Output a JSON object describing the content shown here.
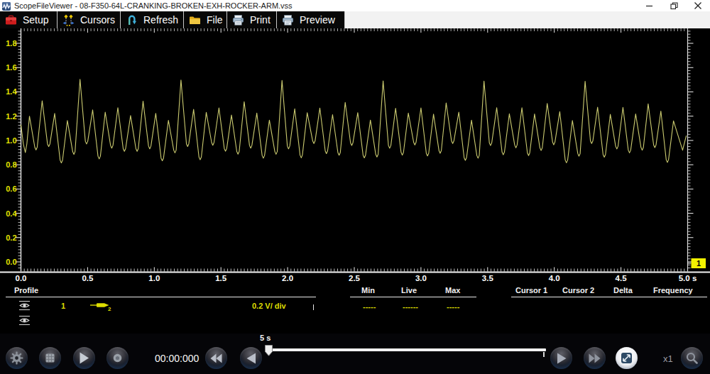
{
  "window": {
    "title": "ScopeFileViewer - 08-F350-64L-CRANKING-BROKEN-EXH-ROCKER-ARM.vss"
  },
  "menu": {
    "items": [
      {
        "label": "Setup"
      },
      {
        "label": "Cursors"
      },
      {
        "label": "Refresh"
      },
      {
        "label": "File"
      },
      {
        "label": "Print"
      },
      {
        "label": "Preview"
      }
    ]
  },
  "chart_data": {
    "type": "line",
    "title": "",
    "xlabel": "s",
    "ylabel": "V",
    "xlim": [
      0,
      5
    ],
    "ylim": [
      0,
      1.8
    ],
    "grid": false,
    "background": "#000000",
    "axis_color": "#ffffff",
    "x_ticks": {
      "values": [
        0,
        0.5,
        1.0,
        1.5,
        2.0,
        2.5,
        3.0,
        3.5,
        4.0,
        4.5,
        5.0
      ],
      "labels": [
        "0.0",
        "0.5",
        "1.0",
        "1.5",
        "2.0",
        "2.5",
        "3.0",
        "3.5",
        "4.0",
        "4.5",
        "5.0 s"
      ],
      "label_color": "#ffffff",
      "minor_step": 0.025
    },
    "y_ticks": {
      "values": [
        0,
        0.2,
        0.4,
        0.6,
        0.8,
        1.0,
        1.2,
        1.4,
        1.6,
        1.8
      ],
      "labels": [
        "0.0",
        "0.2",
        "0.4",
        "0.6",
        "0.8",
        "1.0",
        "1.2",
        "1.4",
        "1.6",
        "1.8"
      ],
      "label_color": "#e3e300",
      "minor_step": 0.025
    },
    "channel_marker": {
      "label": "1",
      "value": 0.0,
      "bg": "#f2f200",
      "fg": "#000000"
    },
    "series": [
      {
        "name": "Channel 1",
        "color": "#cbcb70",
        "scale": "0.2 V/ div",
        "points": [
          [
            0.0,
            1.13
          ],
          [
            0.018,
            0.97
          ],
          [
            0.033,
            0.9
          ],
          [
            0.044,
            0.97
          ],
          [
            0.064,
            1.2
          ],
          [
            0.104,
            0.944
          ],
          [
            0.113,
            0.922
          ],
          [
            0.122,
            0.944
          ],
          [
            0.159,
            1.327
          ],
          [
            0.199,
            0.971
          ],
          [
            0.208,
            0.949
          ],
          [
            0.217,
            0.971
          ],
          [
            0.253,
            1.222
          ],
          [
            0.294,
            0.837
          ],
          [
            0.303,
            0.815
          ],
          [
            0.312,
            0.837
          ],
          [
            0.348,
            1.164
          ],
          [
            0.388,
            0.907
          ],
          [
            0.397,
            0.885
          ],
          [
            0.406,
            0.907
          ],
          [
            0.443,
            1.503
          ],
          [
            0.483,
            0.993
          ],
          [
            0.492,
            0.971
          ],
          [
            0.501,
            0.993
          ],
          [
            0.538,
            1.252
          ],
          [
            0.578,
            0.87
          ],
          [
            0.587,
            0.848
          ],
          [
            0.596,
            0.87
          ],
          [
            0.632,
            1.233
          ],
          [
            0.672,
            0.959
          ],
          [
            0.681,
            0.937
          ],
          [
            0.69,
            0.959
          ],
          [
            0.727,
            1.27
          ],
          [
            0.767,
            0.932
          ],
          [
            0.776,
            0.91
          ],
          [
            0.785,
            0.932
          ],
          [
            0.822,
            1.205
          ],
          [
            0.862,
            0.932
          ],
          [
            0.871,
            0.91
          ],
          [
            0.88,
            0.932
          ],
          [
            0.916,
            1.323
          ],
          [
            0.957,
            0.953
          ],
          [
            0.966,
            0.931
          ],
          [
            0.975,
            0.953
          ],
          [
            1.011,
            1.223
          ],
          [
            1.051,
            0.854
          ],
          [
            1.06,
            0.832
          ],
          [
            1.069,
            0.854
          ],
          [
            1.106,
            1.166
          ],
          [
            1.146,
            0.92
          ],
          [
            1.155,
            0.898
          ],
          [
            1.164,
            0.92
          ],
          [
            1.2,
            1.498
          ],
          [
            1.241,
            0.972
          ],
          [
            1.25,
            0.95
          ],
          [
            1.259,
            0.972
          ],
          [
            1.295,
            1.256
          ],
          [
            1.335,
            0.863
          ],
          [
            1.344,
            0.841
          ],
          [
            1.353,
            0.863
          ],
          [
            1.39,
            1.231
          ],
          [
            1.43,
            0.982
          ],
          [
            1.439,
            0.96
          ],
          [
            1.448,
            0.982
          ],
          [
            1.485,
            1.268
          ],
          [
            1.525,
            0.933
          ],
          [
            1.534,
            0.911
          ],
          [
            1.543,
            0.933
          ],
          [
            1.579,
            1.209
          ],
          [
            1.619,
            0.909
          ],
          [
            1.628,
            0.887
          ],
          [
            1.637,
            0.909
          ],
          [
            1.674,
            1.319
          ],
          [
            1.714,
            0.959
          ],
          [
            1.723,
            0.937
          ],
          [
            1.732,
            0.959
          ],
          [
            1.769,
            1.225
          ],
          [
            1.809,
            0.876
          ],
          [
            1.818,
            0.854
          ],
          [
            1.827,
            0.876
          ],
          [
            1.863,
            1.168
          ],
          [
            1.904,
            0.908
          ],
          [
            1.913,
            0.886
          ],
          [
            1.922,
            0.908
          ],
          [
            1.958,
            1.494
          ],
          [
            1.998,
            0.953
          ],
          [
            2.007,
            0.931
          ],
          [
            2.016,
            0.953
          ],
          [
            2.053,
            1.261
          ],
          [
            2.093,
            0.879
          ],
          [
            2.102,
            0.857
          ],
          [
            2.111,
            0.879
          ],
          [
            2.147,
            1.228
          ],
          [
            2.188,
            0.996
          ],
          [
            2.197,
            0.974
          ],
          [
            2.206,
            0.996
          ],
          [
            2.242,
            1.267
          ],
          [
            2.282,
            0.913
          ],
          [
            2.291,
            0.891
          ],
          [
            2.3,
            0.913
          ],
          [
            2.337,
            1.213
          ],
          [
            2.377,
            0.9
          ],
          [
            2.386,
            0.878
          ],
          [
            2.395,
            0.9
          ],
          [
            2.432,
            1.314
          ],
          [
            2.472,
            0.981
          ],
          [
            2.481,
            0.959
          ],
          [
            2.49,
            0.981
          ],
          [
            2.526,
            1.229
          ],
          [
            2.566,
            0.878
          ],
          [
            2.575,
            0.856
          ],
          [
            2.584,
            0.878
          ],
          [
            2.621,
            1.168
          ],
          [
            2.661,
            0.885
          ],
          [
            2.67,
            0.863
          ],
          [
            2.679,
            0.885
          ],
          [
            2.716,
            1.49
          ],
          [
            2.756,
            0.958
          ],
          [
            2.765,
            0.936
          ],
          [
            2.774,
            0.958
          ],
          [
            2.81,
            1.265
          ],
          [
            2.851,
            0.901
          ],
          [
            2.86,
            0.879
          ],
          [
            2.869,
            0.901
          ],
          [
            2.905,
            1.225
          ],
          [
            2.945,
            0.985
          ],
          [
            2.954,
            0.963
          ],
          [
            2.963,
            0.985
          ],
          [
            3.0,
            1.268
          ],
          [
            3.04,
            0.894
          ],
          [
            3.049,
            0.872
          ],
          [
            3.058,
            0.894
          ],
          [
            3.094,
            1.216
          ],
          [
            3.135,
            0.916
          ],
          [
            3.144,
            0.894
          ],
          [
            3.153,
            0.916
          ],
          [
            3.189,
            1.309
          ],
          [
            3.229,
            0.996
          ],
          [
            3.238,
            0.974
          ],
          [
            3.247,
            0.996
          ],
          [
            3.284,
            1.233
          ],
          [
            3.324,
            0.858
          ],
          [
            3.333,
            0.836
          ],
          [
            3.342,
            0.858
          ],
          [
            3.379,
            1.167
          ],
          [
            3.419,
            0.876
          ],
          [
            3.428,
            0.854
          ],
          [
            3.437,
            0.876
          ],
          [
            3.473,
            1.488
          ],
          [
            3.513,
            0.98
          ],
          [
            3.522,
            0.958
          ],
          [
            3.531,
            0.98
          ],
          [
            3.568,
            1.27
          ],
          [
            3.608,
            0.904
          ],
          [
            3.617,
            0.882
          ],
          [
            3.626,
            0.904
          ],
          [
            3.663,
            1.22
          ],
          [
            3.703,
            0.962
          ],
          [
            3.712,
            0.94
          ],
          [
            3.721,
            0.962
          ],
          [
            3.757,
            1.269
          ],
          [
            3.798,
            0.897
          ],
          [
            3.807,
            0.875
          ],
          [
            3.816,
            0.897
          ],
          [
            3.852,
            1.218
          ],
          [
            3.892,
            0.939
          ],
          [
            3.901,
            0.917
          ],
          [
            3.91,
            0.939
          ],
          [
            3.947,
            1.305
          ],
          [
            3.987,
            0.986
          ],
          [
            3.996,
            0.964
          ],
          [
            4.005,
            0.986
          ],
          [
            4.041,
            1.237
          ],
          [
            4.082,
            0.838
          ],
          [
            4.091,
            0.816
          ],
          [
            4.1,
            0.838
          ],
          [
            4.136,
            1.164
          ],
          [
            4.176,
            0.892
          ],
          [
            4.185,
            0.87
          ],
          [
            4.194,
            0.892
          ],
          [
            4.231,
            1.487
          ],
          [
            4.271,
            0.996
          ],
          [
            4.28,
            0.974
          ],
          [
            4.289,
            0.996
          ],
          [
            4.325,
            1.274
          ],
          [
            4.366,
            0.884
          ],
          [
            4.375,
            0.862
          ],
          [
            4.384,
            0.884
          ],
          [
            4.42,
            1.215
          ],
          [
            4.46,
            0.952
          ],
          [
            4.469,
            0.93
          ],
          [
            4.478,
            0.952
          ],
          [
            4.515,
            1.273
          ],
          [
            4.555,
            0.92
          ],
          [
            4.564,
            0.898
          ],
          [
            4.573,
            0.92
          ],
          [
            4.61,
            1.218
          ],
          [
            4.65,
            0.942
          ],
          [
            4.659,
            0.92
          ],
          [
            4.668,
            0.942
          ],
          [
            4.704,
            1.301
          ],
          [
            4.745,
            0.963
          ],
          [
            4.754,
            0.941
          ],
          [
            4.763,
            0.963
          ],
          [
            4.799,
            1.242
          ],
          [
            4.839,
            0.841
          ],
          [
            4.848,
            0.819
          ],
          [
            4.857,
            0.841
          ],
          [
            4.894,
            1.161
          ],
          [
            4.962,
            0.92
          ],
          [
            4.99,
            1.04
          ]
        ]
      }
    ]
  },
  "readout": {
    "profile_header": "Profile",
    "channel_row": {
      "channel": "1",
      "scale": "0.2 V/ div",
      "probe_label": "2"
    },
    "stats": {
      "headers": [
        "Min",
        "Live",
        "Max"
      ],
      "values": [
        "-----",
        "------",
        "-----"
      ]
    },
    "cursor_headers": [
      "Cursor 1",
      "Cursor 2",
      "Delta",
      "Frequency"
    ]
  },
  "transport": {
    "time": "00:00:000",
    "slider_label": "5 s",
    "zoom_factor": "x1"
  }
}
